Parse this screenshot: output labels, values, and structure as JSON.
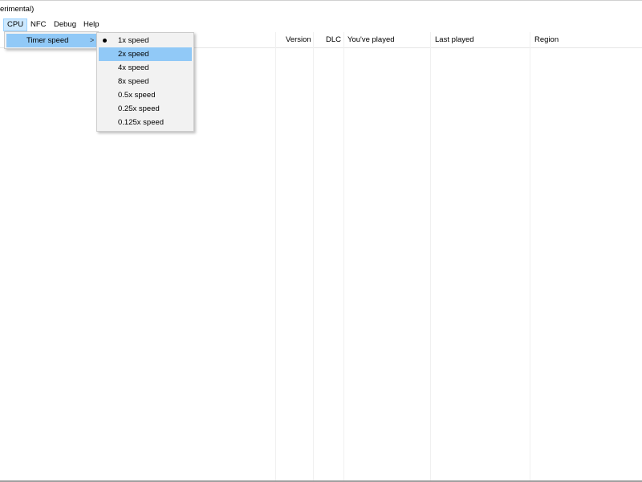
{
  "window": {
    "title": "erimental)"
  },
  "menubar": {
    "items": [
      {
        "label": "CPU"
      },
      {
        "label": "NFC"
      },
      {
        "label": "Debug"
      },
      {
        "label": "Help"
      }
    ]
  },
  "cpu_menu": {
    "items": [
      {
        "label": "Timer speed",
        "submenu_arrow": ">"
      }
    ]
  },
  "timer_speed_menu": {
    "items": [
      {
        "label": "1x speed",
        "selected": true
      },
      {
        "label": "2x speed",
        "highlighted": true
      },
      {
        "label": "4x speed"
      },
      {
        "label": "8x speed"
      },
      {
        "label": "0.5x speed"
      },
      {
        "label": "0.25x speed"
      },
      {
        "label": "0.125x speed"
      }
    ]
  },
  "game_list": {
    "columns": [
      {
        "label": "Version"
      },
      {
        "label": "DLC"
      },
      {
        "label": "You've played"
      },
      {
        "label": "Last played"
      },
      {
        "label": "Region"
      }
    ]
  },
  "colors": {
    "menu_active_bg": "#cce8ff",
    "submenu_highlight_bg": "#91c9f7",
    "menu_bg": "#f2f2f2"
  }
}
